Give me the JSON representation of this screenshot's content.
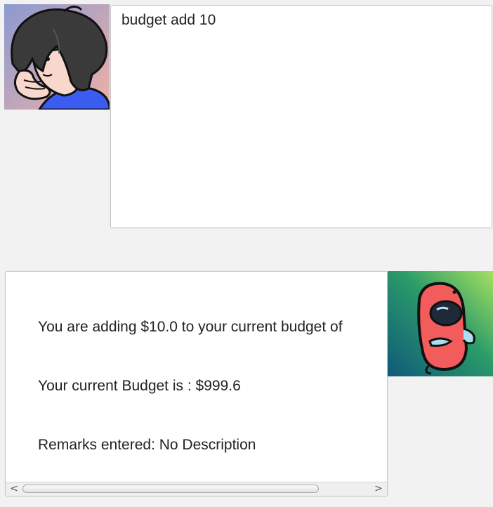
{
  "user_message": {
    "text": "budget add 10",
    "avatar_icon": "user-avatar-cartoon-icon"
  },
  "bot_message": {
    "lines": [
      "You are adding $10.0 to your current budget of",
      "Your current Budget is : $999.6",
      "Remarks entered: No Description"
    ],
    "avatar_icon": "bot-avatar-red-blob-icon"
  },
  "scrollbar": {
    "left_arrow": "<",
    "right_arrow": ">"
  },
  "colors": {
    "background": "#f2f2f2",
    "bubble": "#ffffff",
    "bubble_border": "#c6c6c6",
    "text": "#222222"
  }
}
